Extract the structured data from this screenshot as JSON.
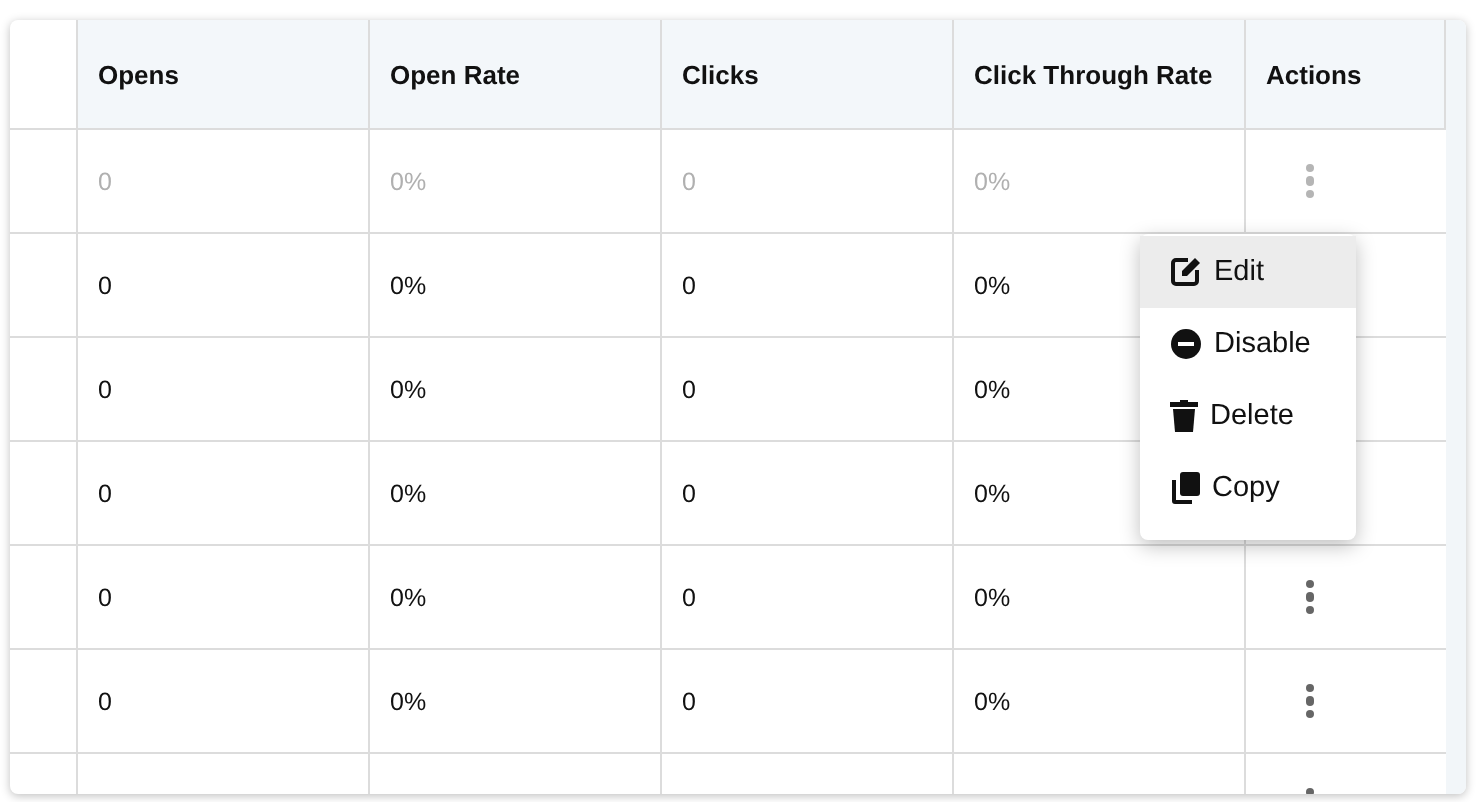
{
  "table": {
    "columns": [
      "Opens",
      "Open Rate",
      "Clicks",
      "Click Through Rate",
      "Actions"
    ],
    "rows": [
      {
        "disabled": true,
        "cells": [
          "0",
          "0%",
          "0",
          "0%"
        ]
      },
      {
        "disabled": false,
        "cells": [
          "0",
          "0%",
          "0",
          "0%"
        ]
      },
      {
        "disabled": false,
        "cells": [
          "0",
          "0%",
          "0",
          "0%"
        ]
      },
      {
        "disabled": false,
        "cells": [
          "0",
          "0%",
          "0",
          "0%"
        ]
      },
      {
        "disabled": false,
        "cells": [
          "0",
          "0%",
          "0",
          "0%"
        ]
      },
      {
        "disabled": false,
        "cells": [
          "0",
          "0%",
          "0",
          "0%"
        ]
      }
    ]
  },
  "action_menu": {
    "items": [
      {
        "label": "Edit",
        "selected": true
      },
      {
        "label": "Disable",
        "selected": false
      },
      {
        "label": "Delete",
        "selected": false
      },
      {
        "label": "Copy",
        "selected": false
      }
    ]
  }
}
